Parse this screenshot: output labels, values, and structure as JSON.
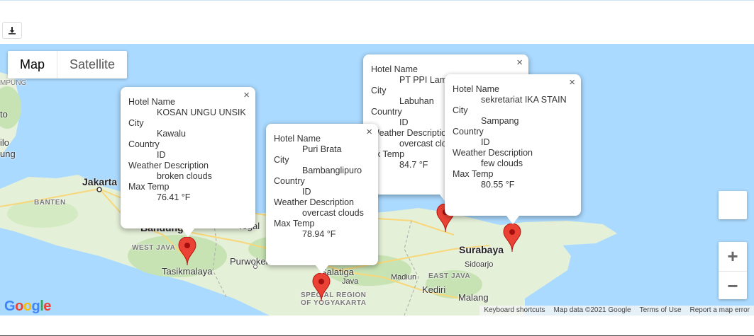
{
  "toolbar": {
    "download_icon": "download-icon"
  },
  "map_type": {
    "map_label": "Map",
    "satellite_label": "Satellite"
  },
  "place_labels": {
    "jakarta": "Jakarta",
    "banten": "BANTEN",
    "bandung": "Bandung",
    "west_java": "WEST JAVA",
    "tasikmalaya": "Tasikmalaya",
    "purwokerto": "Purwokerto",
    "tegal": "Tegal",
    "salatiga": "Salatiga",
    "java": "Java",
    "special_region_1": "SPECIAL REGION",
    "special_region_2": "OF YOGYAKARTA",
    "surabaya": "Surabaya",
    "sidoarjo": "Sidoarjo",
    "madiun": "Madiun",
    "east_java": "EAST JAVA",
    "kediri": "Kediri",
    "malang": "Malang",
    "lampung": "MPUNG",
    "left_edge_1": "to",
    "left_edge_2": "ilo",
    "left_edge_3": "ung"
  },
  "info_windows": [
    {
      "name_label": "Hotel Name",
      "name": "KOSAN UNGU UNSIK",
      "city_label": "City",
      "city": "Kawalu",
      "country_label": "Country",
      "country": "ID",
      "weather_label": "Weather Description",
      "weather": "broken clouds",
      "temp_label": "Max Temp",
      "temp": "76.41 °F",
      "close": "×"
    },
    {
      "name_label": "Hotel Name",
      "name": "Puri Brata",
      "city_label": "City",
      "city": "Bambanglipuro",
      "country_label": "Country",
      "country": "ID",
      "weather_label": "Weather Description",
      "weather": "overcast clouds",
      "temp_label": "Max Temp",
      "temp": "78.94 °F",
      "close": "×"
    },
    {
      "name_label": "Hotel Name",
      "name": "PT PPI Lam",
      "city_label": "City",
      "city": "Labuhan",
      "country_label": "Country",
      "country": "ID",
      "weather_label": "Weather Descriptio",
      "weather": "overcast clo",
      "temp_label": "ax Temp",
      "temp": "84.7 °F",
      "close": "×"
    },
    {
      "name_label": "Hotel Name",
      "name": "sekretariat IKA STAIN",
      "city_label": "City",
      "city": "Sampang",
      "country_label": "Country",
      "country": "ID",
      "weather_label": "Weather Description",
      "weather": "few clouds",
      "temp_label": "Max Temp",
      "temp": "80.55 °F",
      "close": "×"
    }
  ],
  "controls": {
    "zoom_in": "+",
    "zoom_out": "−"
  },
  "attribution": {
    "logo": "Google",
    "keyboard": "Keyboard shortcuts",
    "map_data": "Map data ©2021 Google",
    "terms": "Terms of Use",
    "report": "Report a map error"
  },
  "colors": {
    "water": "#aadaff",
    "land": "#e8f3dc",
    "pin": "#ea4335"
  }
}
